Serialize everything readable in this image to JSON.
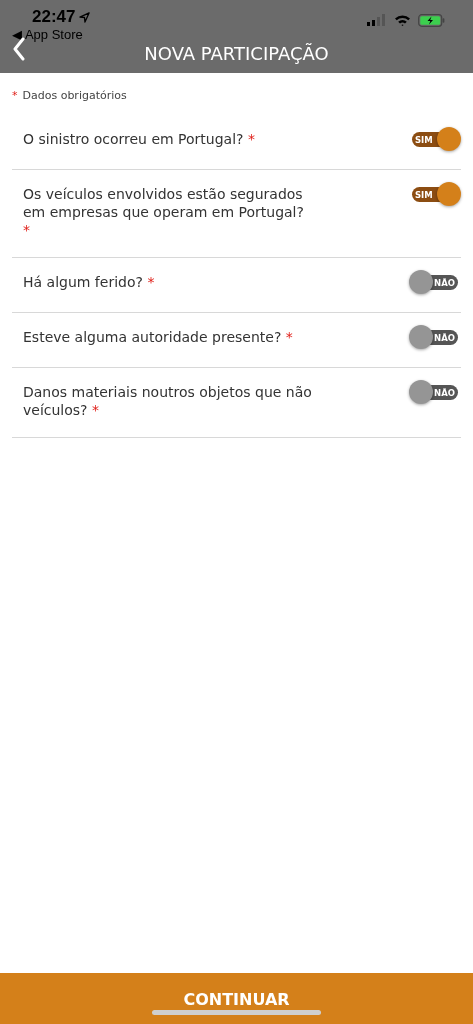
{
  "status_bar": {
    "time": "22:47",
    "back_app": "◀ App Store"
  },
  "header": {
    "title": "NOVA PARTICIPAÇÃO"
  },
  "legend": {
    "mark": "*",
    "text": "Dados obrigatórios"
  },
  "questions": [
    {
      "label": "O sinistro ocorreu em Portugal?",
      "mark": "*",
      "on": true,
      "toggle_text": "SIM"
    },
    {
      "label": "Os veículos envolvidos estão segurados em empresas que operam em Portugal?",
      "mark": "*",
      "on": true,
      "toggle_text": "SIM"
    },
    {
      "label": "Há algum ferido?",
      "mark": "*",
      "on": false,
      "toggle_text": "NÃO"
    },
    {
      "label": "Esteve alguma autoridade presente?",
      "mark": "*",
      "on": false,
      "toggle_text": "NÃO"
    },
    {
      "label": "Danos materiais noutros objetos que não veículos?",
      "mark": "*",
      "on": false,
      "toggle_text": "NÃO"
    }
  ],
  "footer": {
    "button": "CONTINUAR"
  }
}
